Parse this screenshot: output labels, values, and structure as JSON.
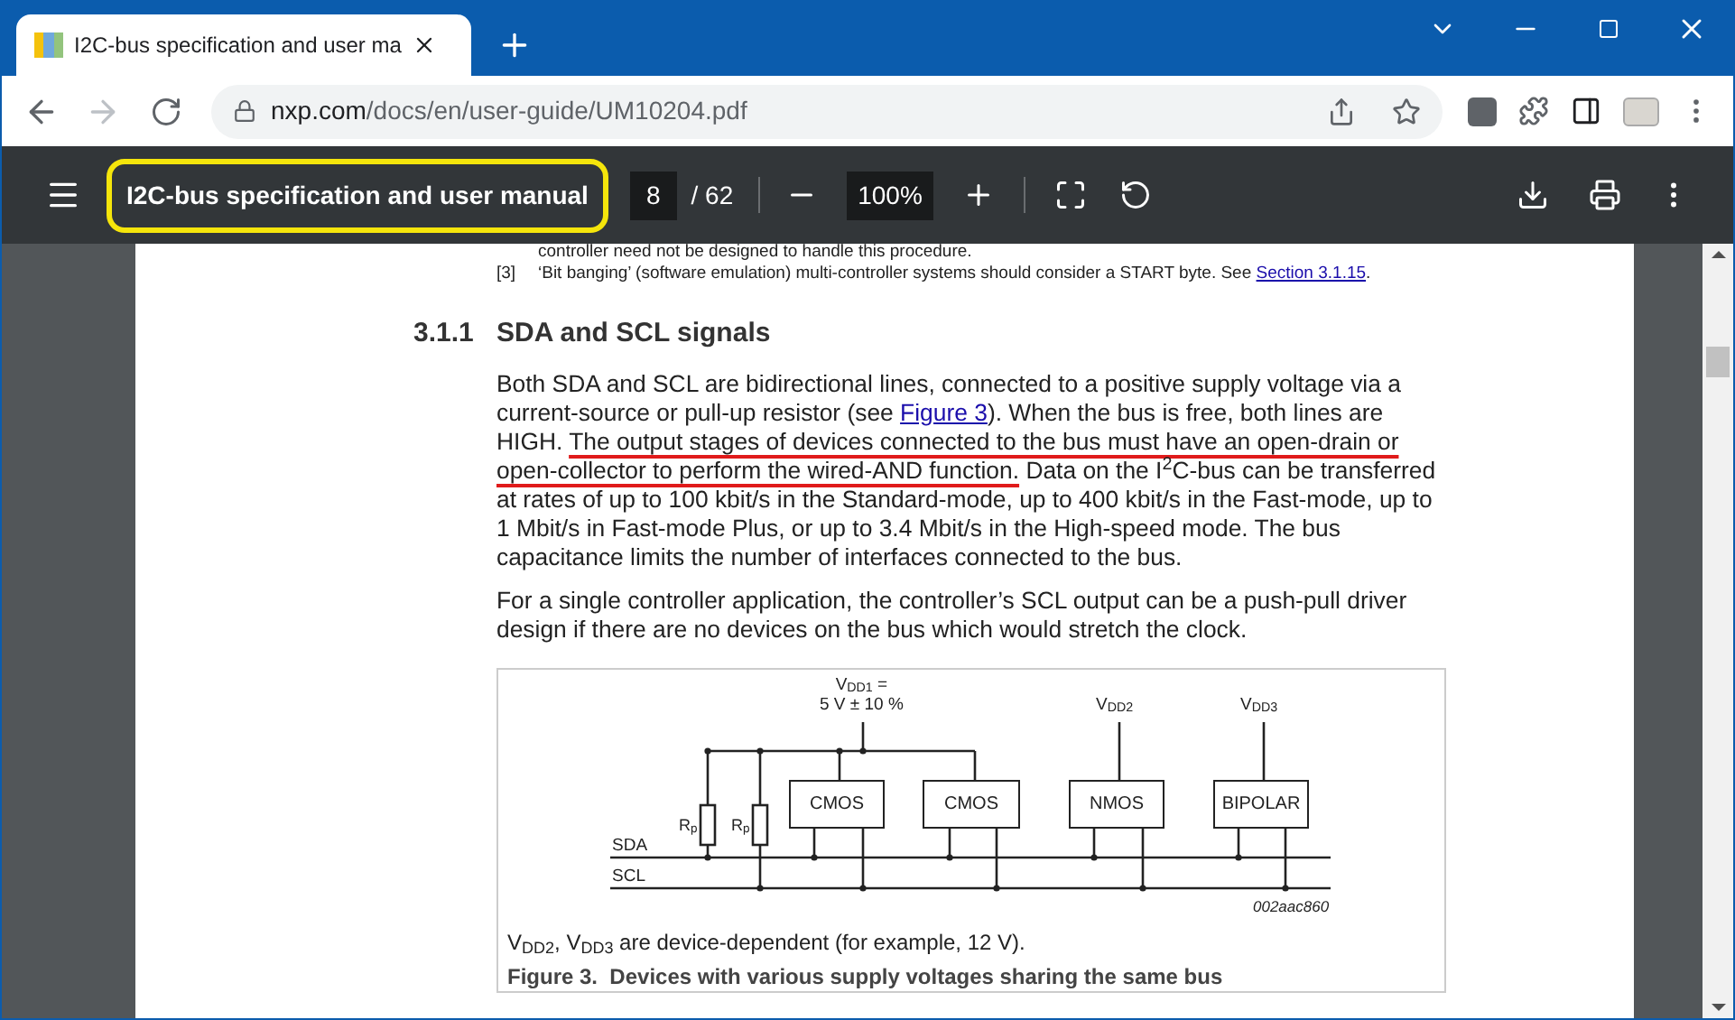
{
  "browser": {
    "tab": {
      "title": "I2C-bus specification and user ma",
      "selected": true
    },
    "address": {
      "host": "nxp.com",
      "path": "/docs/en/user-guide/UM10204.pdf"
    },
    "back_disabled": false,
    "forward_disabled": true
  },
  "pdf_toolbar": {
    "title": "I2C-bus specification and user manual",
    "title_highlighted": true,
    "page": "8",
    "page_total": "/ 62",
    "zoom": "100%"
  },
  "page": {
    "footnotes": [
      {
        "text": "controller need not be designed to handle this procedure."
      },
      {
        "mark": "[3]",
        "text": "‘Bit banging’ (software emulation) multi-controller systems should consider a START byte. See ",
        "link": "Section 3.1.15",
        "after": "."
      }
    ],
    "section": {
      "number": "3.1.1",
      "title": "SDA and SCL signals"
    },
    "paragraphs": [
      {
        "parts": [
          {
            "text": "Both SDA and SCL are bidirectional lines, connected to a positive supply voltage via a current-source or pull-up resistor (see ",
            "kind": "plain"
          },
          {
            "text": "Figure 3",
            "kind": "link"
          },
          {
            "text": "). When the bus is free, both lines are HIGH. ",
            "kind": "plain"
          },
          {
            "text": "The output stages of devices connected to the bus must have an open-drain or open-collector to perform the wired-AND function.",
            "kind": "underlined"
          },
          {
            "text": " Data on the I$^{2}$C-bus can be transferred at rates of up to 100 kbit/s in the Standard-mode, up to 400 kbit/s in the Fast-mode, up to 1 Mbit/s in Fast-mode Plus, or up to 3.4 Mbit/s in the High-speed mode. The bus capacitance limits the number of interfaces connected to the bus.",
            "kind": "plain"
          }
        ]
      },
      {
        "parts": [
          {
            "text": "For a single controller application, the controller’s SCL output can be a push-pull driver design if there are no devices on the bus which would stretch the clock.",
            "kind": "plain"
          }
        ]
      }
    ],
    "figure": {
      "supply_1": [
        "V$_{DD1}$ =",
        "5 V ± 10 %"
      ],
      "supply_2": "V$_{DD2}$",
      "supply_3": "V$_{DD3}$",
      "resistors": [
        "R$_{p}$",
        "R$_{p}$"
      ],
      "devices": [
        "CMOS",
        "CMOS",
        "NMOS",
        "BIPOLAR"
      ],
      "lines": [
        "SDA",
        "SCL"
      ],
      "code": "002aac860",
      "note": "V$_{DD2}$, V$_{DD3}$ are device-dependent (for example, 12 V).",
      "caption": "Figure 3.  Devices with various supply voltages sharing the same bus"
    }
  }
}
